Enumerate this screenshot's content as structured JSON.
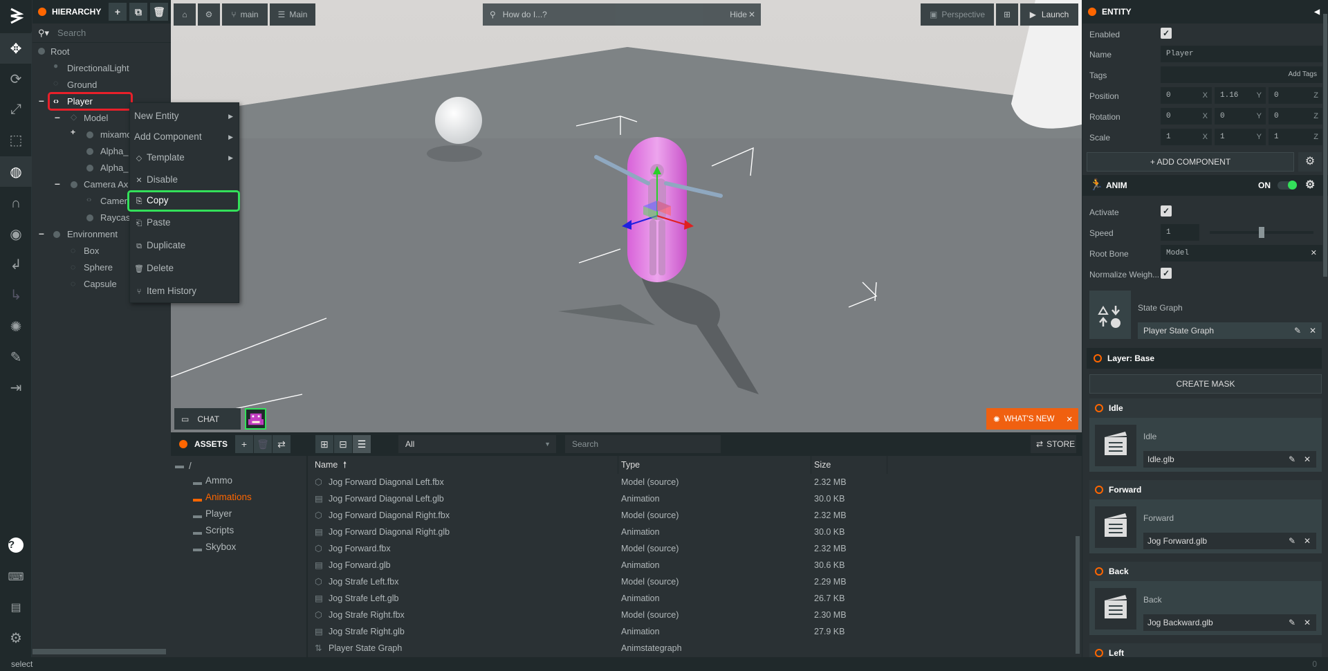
{
  "hierarchy": {
    "title": "HIERARCHY",
    "search_placeholder": "Search",
    "items": [
      {
        "label": "Root"
      },
      {
        "label": "DirectionalLight"
      },
      {
        "label": "Ground"
      },
      {
        "label": "Player"
      },
      {
        "label": "Model"
      },
      {
        "label": "mixamo"
      },
      {
        "label": "Alpha_"
      },
      {
        "label": "Alpha_"
      },
      {
        "label": "Camera Ax"
      },
      {
        "label": "Camer"
      },
      {
        "label": "Raycas"
      },
      {
        "label": "Environment"
      },
      {
        "label": "Box"
      },
      {
        "label": "Sphere"
      },
      {
        "label": "Capsule"
      }
    ]
  },
  "context_menu": {
    "items": [
      {
        "label": "New Entity"
      },
      {
        "label": "Add Component"
      },
      {
        "label": "Template"
      },
      {
        "label": "Disable"
      },
      {
        "label": "Copy"
      },
      {
        "label": "Paste"
      },
      {
        "label": "Duplicate"
      },
      {
        "label": "Delete"
      },
      {
        "label": "Item History"
      }
    ]
  },
  "viewport": {
    "branch": "main",
    "scene": "Main",
    "help_placeholder": "How do I...?",
    "help_hide": "Hide",
    "camera": "Perspective",
    "launch": "Launch",
    "chat": "CHAT",
    "whats_new": "WHAT'S NEW"
  },
  "assets": {
    "title": "ASSETS",
    "filter": "All",
    "search_placeholder": "Search",
    "store": "STORE",
    "root": "/",
    "folders": [
      "Ammo",
      "Animations",
      "Player",
      "Scripts",
      "Skybox"
    ],
    "columns": {
      "name": "Name",
      "type": "Type",
      "size": "Size"
    },
    "files": [
      {
        "name": "Jog Forward Diagonal Left.fbx",
        "type": "Model (source)",
        "size": "2.32 MB"
      },
      {
        "name": "Jog Forward Diagonal Left.glb",
        "type": "Animation",
        "size": "30.0 KB"
      },
      {
        "name": "Jog Forward Diagonal Right.fbx",
        "type": "Model (source)",
        "size": "2.32 MB"
      },
      {
        "name": "Jog Forward Diagonal Right.glb",
        "type": "Animation",
        "size": "30.0 KB"
      },
      {
        "name": "Jog Forward.fbx",
        "type": "Model (source)",
        "size": "2.32 MB"
      },
      {
        "name": "Jog Forward.glb",
        "type": "Animation",
        "size": "30.6 KB"
      },
      {
        "name": "Jog Strafe Left.fbx",
        "type": "Model (source)",
        "size": "2.29 MB"
      },
      {
        "name": "Jog Strafe Left.glb",
        "type": "Animation",
        "size": "26.7 KB"
      },
      {
        "name": "Jog Strafe Right.fbx",
        "type": "Model (source)",
        "size": "2.30 MB"
      },
      {
        "name": "Jog Strafe Right.glb",
        "type": "Animation",
        "size": "27.9 KB"
      },
      {
        "name": "Player State Graph",
        "type": "Animstategraph",
        "size": ""
      }
    ]
  },
  "inspector": {
    "title": "ENTITY",
    "enabled_label": "Enabled",
    "name_label": "Name",
    "name_value": "Player",
    "tags_label": "Tags",
    "add_tags": "Add Tags",
    "position_label": "Position",
    "position": [
      "0",
      "1.16",
      "0"
    ],
    "rotation_label": "Rotation",
    "rotation": [
      "0",
      "0",
      "0"
    ],
    "scale_label": "Scale",
    "scale": [
      "1",
      "1",
      "1"
    ],
    "axes": [
      "X",
      "Y",
      "Z"
    ],
    "add_component": "ADD COMPONENT",
    "anim": {
      "title": "ANIM",
      "on": "ON",
      "activate_label": "Activate",
      "speed_label": "Speed",
      "speed_value": "1",
      "speed_level": 0.5,
      "root_bone_label": "Root Bone",
      "root_bone_value": "Model",
      "normalize_label": "Normalize Weigh...",
      "state_graph_label": "State Graph",
      "state_graph_value": "Player State Graph",
      "layer_label": "Layer: Base",
      "create_mask": "CREATE MASK",
      "states": [
        {
          "name": "Idle",
          "clip_label": "Idle",
          "clip": "Idle.glb"
        },
        {
          "name": "Forward",
          "clip_label": "Forward",
          "clip": "Jog Forward.glb"
        },
        {
          "name": "Back",
          "clip_label": "Back",
          "clip": "Jog Backward.glb"
        },
        {
          "name": "Left"
        }
      ]
    }
  },
  "status": {
    "text": "select",
    "count": "0"
  },
  "colors": {
    "accent": "#ff6600",
    "highlight_red": "#e8202a",
    "highlight_green": "#33e05a"
  }
}
